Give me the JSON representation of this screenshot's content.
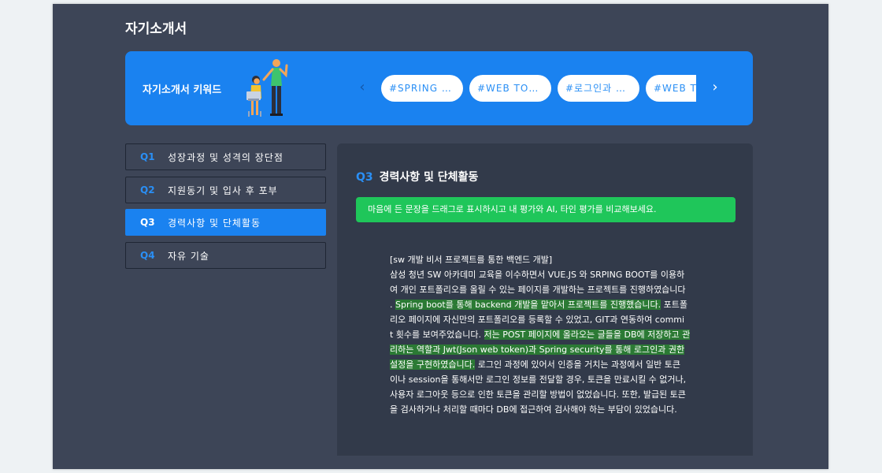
{
  "page": {
    "title": "자기소개서"
  },
  "banner": {
    "title": "자기소개서 키워드",
    "illustration_icon": "people-illustration",
    "prev_icon": "chevron-left-icon",
    "next_icon": "chevron-right-icon",
    "prev_glyph": "‹",
    "next_glyph": "›",
    "keywords": [
      "#SPRING BOOT",
      "#WEB TOKEN",
      "#로그인과 권한",
      "#WEB TOKEN"
    ]
  },
  "questions": [
    {
      "num": "Q1",
      "label": "성장과정 및 성격의 장단점"
    },
    {
      "num": "Q2",
      "label": "지원동기 및 입사 후 포부"
    },
    {
      "num": "Q3",
      "label": "경력사항 및 단체활동"
    },
    {
      "num": "Q4",
      "label": "자유 기술"
    }
  ],
  "content": {
    "qnum": "Q3",
    "title": "경력사항 및 단체활동",
    "notice": "마음에 든 문장을 드래그로 표시하시고 내 평가와 AI, 타인 평가를 비교해보세요.",
    "lines": [
      [
        {
          "t": "[sw 개발 비서 프로젝트를 통한 백엔드 개발]",
          "h": false
        }
      ],
      [
        {
          "t": "삼성 청년 SW 아카데미 교육을 이수하면서 VUE.JS 와 SRPING BOOT를 이용하",
          "h": false
        }
      ],
      [
        {
          "t": "여 개인 포트폴리오를 올릴 수 있는 페이지를 개발하는 프로젝트를 진행하였습니다",
          "h": false
        }
      ],
      [
        {
          "t": ". ",
          "h": false
        },
        {
          "t": "Spring boot를 통해 backend 개발을 맡아서 프로젝트를 진행했습니다.",
          "h": true
        },
        {
          "t": " 포트폴",
          "h": false
        }
      ],
      [
        {
          "t": "리오 페이지에 자신만의 포트폴리오를 등록할 수 있었고, GIT과 연동하여 commi",
          "h": false
        }
      ],
      [
        {
          "t": "t 횟수를 보여주었습니다. ",
          "h": false
        },
        {
          "t": "저는 POST 페이지에 올라오는 글들을 DB에 저장하고 관",
          "h": true
        }
      ],
      [
        {
          "t": "리하는 역할과 Jwt(Json web token)과 Spring security를 통해 로그인과 권한",
          "h": true
        }
      ],
      [
        {
          "t": " 설정을 구현하였습니다.",
          "h": true
        },
        {
          "t": " 로그인 과정에 있어서 인증을 거치는 과정에서 일반 토큰",
          "h": false
        }
      ],
      [
        {
          "t": "이나 session을 통해서만 로그인 정보를 전달할 경우, 토큰을 만료시킬 수 없거나,",
          "h": false
        }
      ],
      [
        {
          "t": " 사용자 로그아웃 등으로 인한 토큰을 관리할 방법이 없었습니다. 또한, 발급된 토큰",
          "h": false
        }
      ],
      [
        {
          "t": "을 검사하거나 처리할 때마다 DB에 접근하여 검사해야 하는 부담이 있었습니다.",
          "h": false
        }
      ]
    ]
  },
  "colors": {
    "background": "#3d4557",
    "accent": "#1a82f0",
    "highlight": "#2b7a34",
    "notice": "#1fc65a"
  }
}
